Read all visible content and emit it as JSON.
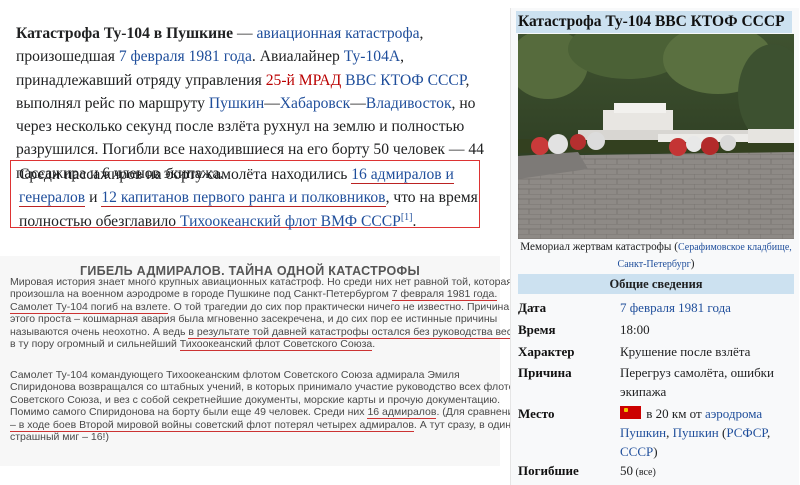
{
  "article": {
    "title_bold": "Катастрофа Ту-104 в Пушкине",
    "dash": " — ",
    "link_air_crash": "авиационная катастрофа",
    "t1": ", произошедшая ",
    "link_date": "7 февраля 1981 года",
    "t2": ". Авиалайнер ",
    "link_tu104a": "Ту-104А",
    "t3": ", принадлежавший отряду управления ",
    "red_25": "25-й МРАД",
    "t4": " ",
    "link_vvs": "ВВС КТОФ СССР",
    "t5": ", выполнял рейс по маршруту ",
    "link_pushkin": "Пушкин",
    "t6": "—",
    "link_khab": "Хабаровск",
    "t7": "—",
    "link_vlad": "Владивосток",
    "t8": ", но через несколько секунд после взлёта рухнул на землю и полностью разрушился. Погибли все находившиеся на его борту 50 человек — 44 пассажира и 6 членов экипажа."
  },
  "callout": {
    "t1": "Среди пассажиров на борту самолёта находились ",
    "link_adm": "16 адмиралов и генералов",
    "t2": " и ",
    "link_capt": "12 капитанов первого ранга и полковников",
    "t3": ", что на время полностью обезглавило ",
    "link_fleet": "Тихоокеанский флот ВМФ СССР",
    "ref": "[1]",
    "t4": "."
  },
  "scan": {
    "title": "ГИБЕЛЬ АДМИРАЛОВ. ТАЙНА ОДНОЙ КАТАСТРОФЫ",
    "p1": {
      "l1": "Мировая история знает много крупных авиационных катастроф. Но среди них нет равной той, которая",
      "l2a": "произошла на военном аэродроме в городе Пушкине под Санкт-Петербургом ",
      "l2u": "7 февраля 1981 года.",
      "l3u": "Самолет Ту-104 погиб на взлете",
      "l3b": ". О той трагедии до сих пор практически ничего не известно. Причина",
      "l4": "этого проста – кошмарная авария была мгновенно засекречена, и до сих пор ее истинные причины",
      "l5a": "называются очень неохотно. А ведь ",
      "l5u": "в результате той давней катастрофы остался без руководства весь",
      "l6a": "в ту пору огромный и сильнейший ",
      "l6u": "Тихоокеанский флот Советского Союза",
      "l6b": "."
    },
    "p2": {
      "l1": "Самолет Ту-104 командующего Тихоокеанским флотом Советского Союза адмирала Эмиля",
      "l2": "Спиридонова возвращался со штабных учений, в которых принимало участие руководство всех флотов",
      "l3": "Советского Союза, и вез с собой секретнейшие документы, морские карты и прочую документацию.",
      "l4a": "Помимо самого Спиридонова на борту были еще 49 человек. Среди них ",
      "l4u": "16 адмиралов",
      "l4b": ". (Для сравнения",
      "l5u": "– в ходе боев Второй мировой войны советский флот потерял четырех адмиралов",
      "l5b": ". А тут сразу, в один",
      "l6": "страшный миг – 16!)"
    }
  },
  "infobox": {
    "title": "Катастрофа Ту-104 ВВС КТОФ СССР",
    "caption_a": "Мемориал жертвам катастрофы (",
    "caption_link": "Серафимовское кладбище, Санкт-Петербург",
    "caption_b": ")",
    "section": "Общие сведения",
    "rows": {
      "date_label": "Дата",
      "date_value": "7 февраля 1981 года",
      "time_label": "Время",
      "time_value": "18:00",
      "char_label": "Характер",
      "char_value": "Крушение после взлёта",
      "cause_label": "Причина",
      "cause_value": "Перегруз самолёта, ошибки экипажа",
      "place_label": "Место",
      "place_a": " в 20 км от ",
      "place_link1": "аэродрома Пушкин",
      "place_b": ", ",
      "place_link2": "Пушкин",
      "place_c": " (",
      "place_link3": "РСФСР",
      "place_d": ", ",
      "place_link4": "СССР",
      "place_e": ")",
      "dead_label": "Погибшие",
      "dead_value": "50",
      "dead_note": " (все)"
    }
  },
  "colors": {
    "link": "#1f4e9b",
    "redlink": "#ba0000",
    "infobox_header": "#cce1f0",
    "callout_border": "#dd3333"
  }
}
